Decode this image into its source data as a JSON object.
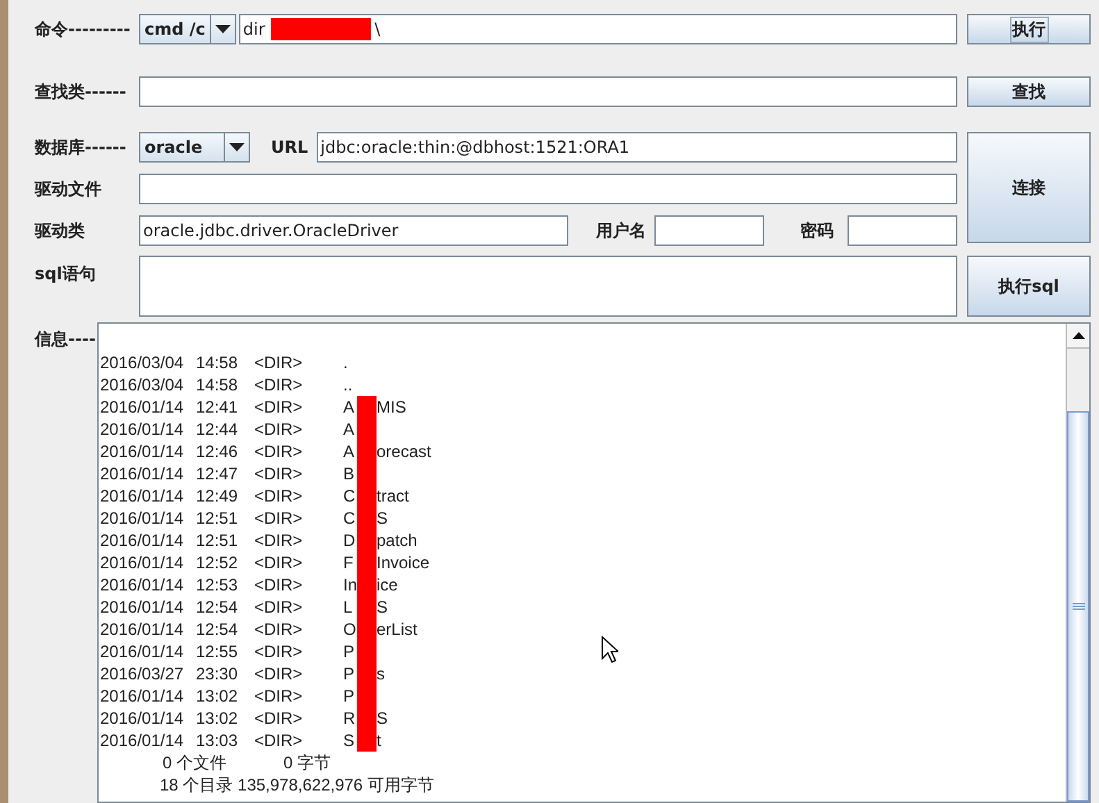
{
  "form": {
    "command": {
      "label": "命令---------",
      "shell": "cmd /c",
      "value_start": "dir ",
      "value_end": "\\",
      "button": "执行",
      "button_focused": true
    },
    "search": {
      "label": "查找类------",
      "button": "查找"
    },
    "database": {
      "label": "数据库------",
      "type": "oracle",
      "url_label": "URL",
      "url": "jdbc:oracle:thin:@dbhost:1521:ORA1"
    },
    "driver_file": {
      "label": "驱动文件"
    },
    "driver_class": {
      "label": "驱动类",
      "value": "oracle.jdbc.driver.OracleDriver",
      "user_label": "用户名",
      "password_label": "密码"
    },
    "connect_button": "连接",
    "sql": {
      "label": "sql语句",
      "button": "执行sql"
    },
    "output_label": "信息----"
  },
  "output": {
    "rows": [
      {
        "date": "2016/03/04",
        "time": "14:58",
        "type": "<DIR>",
        "name_start": ".",
        "redacted": false
      },
      {
        "date": "2016/03/04",
        "time": "14:58",
        "type": "<DIR>",
        "name_start": "..",
        "redacted": false
      },
      {
        "date": "2016/01/14",
        "time": "12:41",
        "type": "<DIR>",
        "name_start": "A",
        "redacted": true,
        "name_end": "MIS"
      },
      {
        "date": "2016/01/14",
        "time": "12:44",
        "type": "<DIR>",
        "name_start": "A",
        "redacted": true
      },
      {
        "date": "2016/01/14",
        "time": "12:46",
        "type": "<DIR>",
        "name_start": "A",
        "redacted": true,
        "name_end": "orecast"
      },
      {
        "date": "2016/01/14",
        "time": "12:47",
        "type": "<DIR>",
        "name_start": "B",
        "redacted": true
      },
      {
        "date": "2016/01/14",
        "time": "12:49",
        "type": "<DIR>",
        "name_start": "C",
        "redacted": true,
        "name_end": "tract"
      },
      {
        "date": "2016/01/14",
        "time": "12:51",
        "type": "<DIR>",
        "name_start": "C",
        "redacted": true,
        "name_end": "S"
      },
      {
        "date": "2016/01/14",
        "time": "12:51",
        "type": "<DIR>",
        "name_start": "D",
        "redacted": true,
        "name_end": "patch"
      },
      {
        "date": "2016/01/14",
        "time": "12:52",
        "type": "<DIR>",
        "name_start": "F",
        "redacted": true,
        "name_end": "Invoice"
      },
      {
        "date": "2016/01/14",
        "time": "12:53",
        "type": "<DIR>",
        "name_start": "In",
        "redacted": true,
        "name_end": "ice"
      },
      {
        "date": "2016/01/14",
        "time": "12:54",
        "type": "<DIR>",
        "name_start": "L",
        "redacted": true,
        "name_end": "S"
      },
      {
        "date": "2016/01/14",
        "time": "12:54",
        "type": "<DIR>",
        "name_start": "O",
        "redacted": true,
        "name_end": "erList"
      },
      {
        "date": "2016/01/14",
        "time": "12:55",
        "type": "<DIR>",
        "name_start": "P",
        "redacted": true
      },
      {
        "date": "2016/03/27",
        "time": "23:30",
        "type": "<DIR>",
        "name_start": "P",
        "redacted": true,
        "name_end": "s"
      },
      {
        "date": "2016/01/14",
        "time": "13:02",
        "type": "<DIR>",
        "name_start": "P",
        "redacted": true
      },
      {
        "date": "2016/01/14",
        "time": "13:02",
        "type": "<DIR>",
        "name_start": "R",
        "redacted": true,
        "name_end": "S"
      },
      {
        "date": "2016/01/14",
        "time": "13:03",
        "type": "<DIR>",
        "name_start": "S",
        "redacted": true,
        "name_end": "t"
      }
    ],
    "summary_files": "0 个文件",
    "summary_file_bytes": "0 字节",
    "summary_dirs": "18 个目录 135,978,622,976 可用字节"
  }
}
